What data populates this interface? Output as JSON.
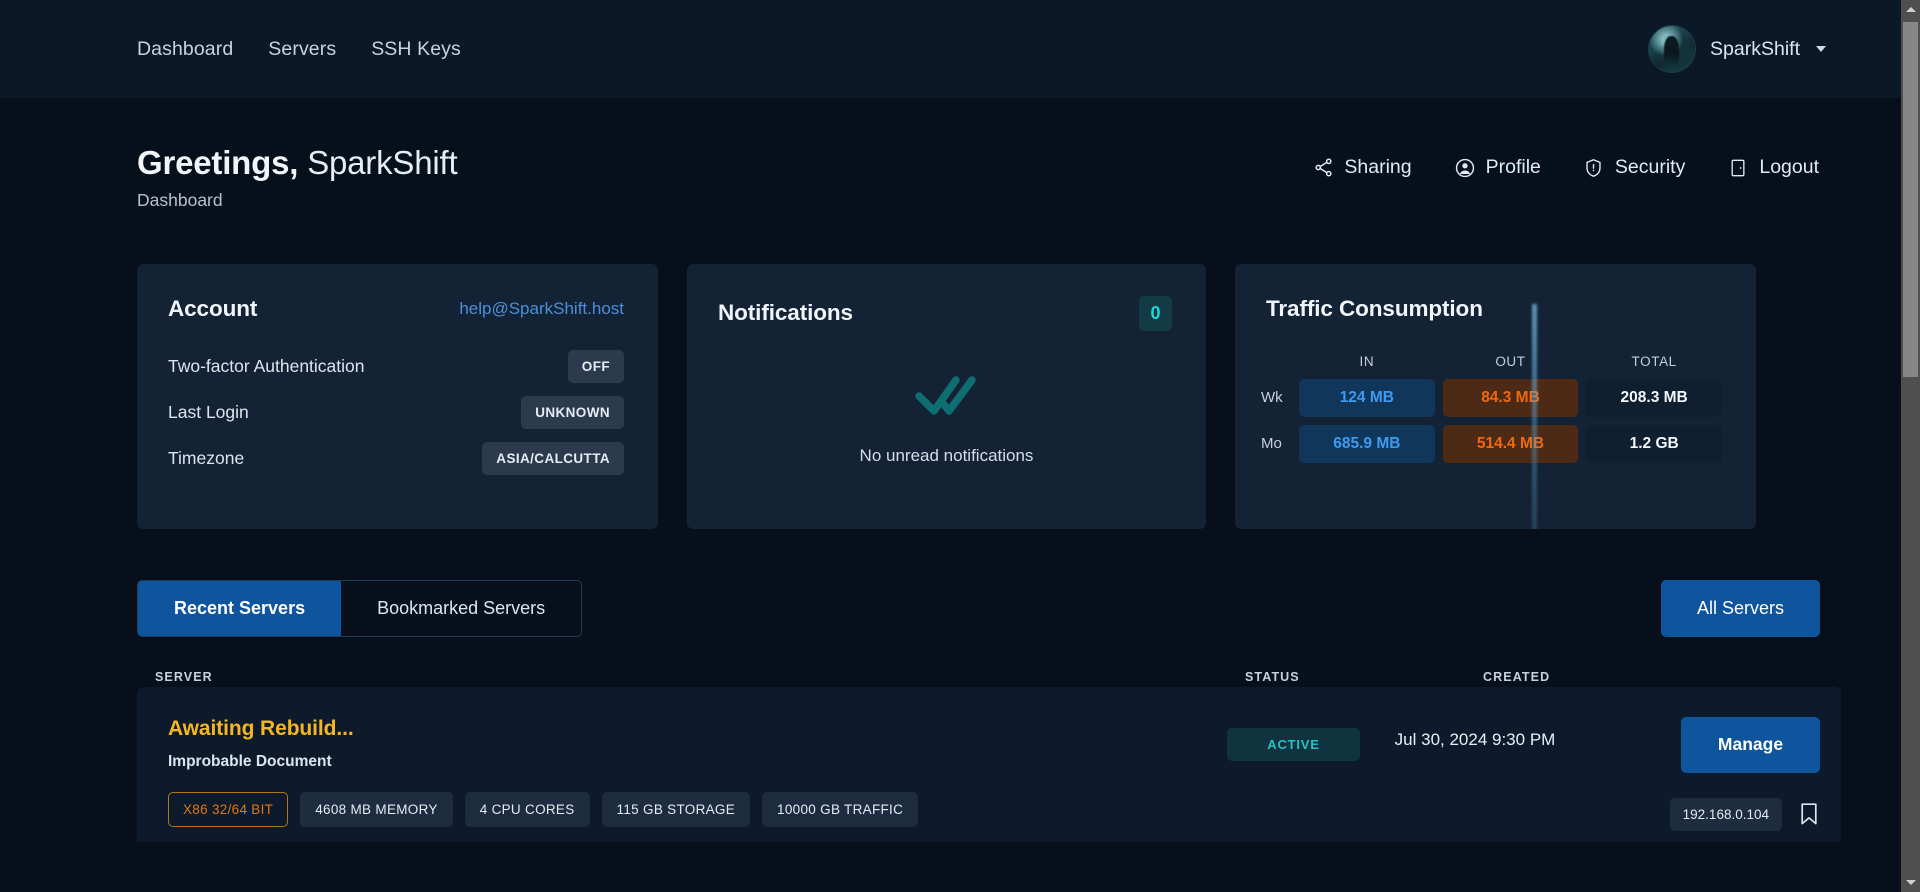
{
  "navbar": {
    "links": [
      {
        "label": "Dashboard"
      },
      {
        "label": "Servers"
      },
      {
        "label": "SSH Keys"
      }
    ],
    "user": {
      "name": "SparkShift",
      "avatar_icon": "user-avatar-image",
      "caret_icon": "chevron-down-icon"
    }
  },
  "header": {
    "greeting_prefix": "Greetings,",
    "greeting_name": "SparkShift",
    "breadcrumb": "Dashboard",
    "quick_actions": [
      {
        "label": "Sharing",
        "icon": "share-nodes-icon"
      },
      {
        "label": "Profile",
        "icon": "user-circle-icon"
      },
      {
        "label": "Security",
        "icon": "shield-exclamation-icon"
      },
      {
        "label": "Logout",
        "icon": "door-exit-icon"
      }
    ]
  },
  "account_card": {
    "title": "Account",
    "email": "help@SparkShift.host",
    "rows": [
      {
        "label": "Two-factor Authentication",
        "value": "OFF"
      },
      {
        "label": "Last Login",
        "value": "UNKNOWN"
      },
      {
        "label": "Timezone",
        "value": "ASIA/CALCUTTA"
      }
    ]
  },
  "notifications_card": {
    "title": "Notifications",
    "count": "0",
    "empty_icon": "double-check-icon",
    "empty_text": "No unread notifications"
  },
  "traffic_card": {
    "title": "Traffic Consumption",
    "columns": [
      "IN",
      "OUT",
      "TOTAL"
    ],
    "rows": [
      {
        "label": "Wk",
        "in": "124 MB",
        "out": "84.3 MB",
        "total": "208.3 MB"
      },
      {
        "label": "Mo",
        "in": "685.9 MB",
        "out": "514.4 MB",
        "total": "1.2 GB"
      }
    ]
  },
  "server_section": {
    "tabs": [
      {
        "label": "Recent Servers",
        "active": true
      },
      {
        "label": "Bookmarked Servers",
        "active": false
      }
    ],
    "all_servers_label": "All Servers",
    "table_headers": {
      "server": "SERVER",
      "status": "STATUS",
      "created": "CREATED"
    },
    "rows": [
      {
        "name": "Awaiting Rebuild...",
        "description": "Improbable Document",
        "specs": [
          "X86 32/64 BIT",
          "4608 MB MEMORY",
          "4 CPU CORES",
          "115 GB STORAGE",
          "10000 GB TRAFFIC"
        ],
        "status": "ACTIVE",
        "created": "Jul 30, 2024 9:30 PM",
        "manage_label": "Manage",
        "ip": "192.168.0.104",
        "bookmark_icon": "bookmark-outline-icon"
      }
    ]
  },
  "colors": {
    "page_bg": "#060f1a",
    "navbar_bg": "#0b1827",
    "card_bg": "#132234",
    "row_bg": "#0c1a2b",
    "accent_blue": "#0e559e",
    "link_blue": "#4a90d9",
    "teal": "#27d3d9",
    "in_blue": "#3c9bf0",
    "out_orange": "#f1690e",
    "server_name_yellow": "#f5b721",
    "arch_chip_orange": "#e0761b"
  }
}
